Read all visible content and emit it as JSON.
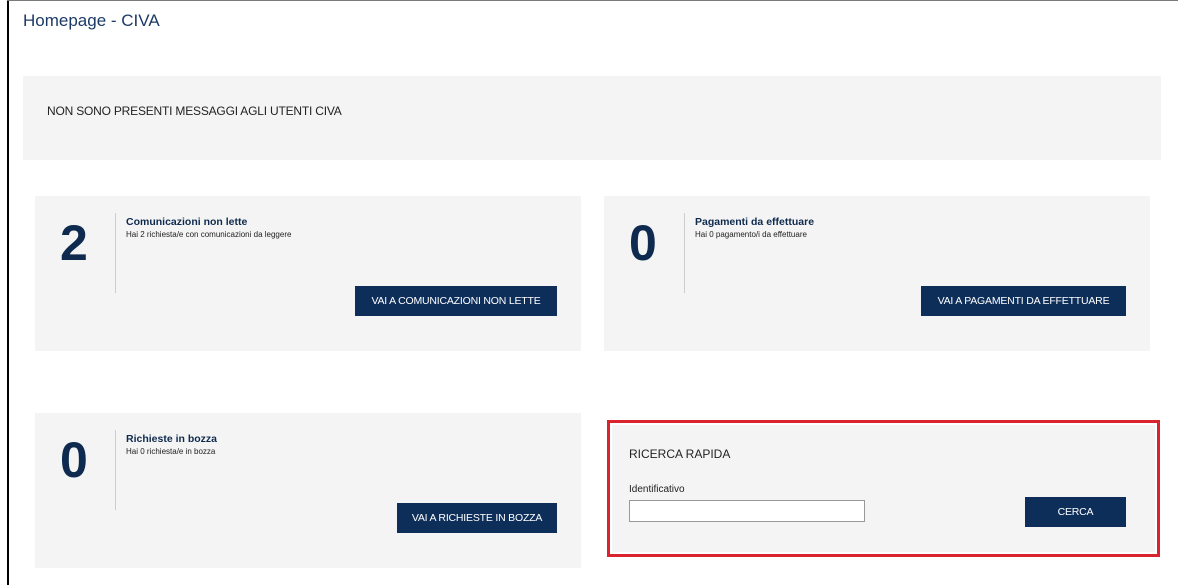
{
  "page": {
    "title": "Homepage - CIVA"
  },
  "messages": {
    "text": "NON SONO PRESENTI MESSAGGI AGLI UTENTI CIVA"
  },
  "cards": {
    "unread": {
      "count": "2",
      "title": "Comunicazioni non lette",
      "subtitle": "Hai 2 richiesta/e con comunicazioni da leggere",
      "button": "VAI A COMUNICAZIONI NON LETTE"
    },
    "payments": {
      "count": "0",
      "title": "Pagamenti da effettuare",
      "subtitle": "Hai 0 pagamento/i da effettuare",
      "button": "VAI A PAGAMENTI DA EFFETTUARE"
    },
    "drafts": {
      "count": "0",
      "title": "Richieste in bozza",
      "subtitle": "Hai 0 richiesta/e in bozza",
      "button": "VAI A RICHIESTE IN BOZZA"
    }
  },
  "quick_search": {
    "title": "RICERCA RAPIDA",
    "field_label": "Identificativo",
    "field_value": "",
    "button": "CERCA"
  },
  "colors": {
    "primary": "#0e2e5a",
    "panel_bg": "#f4f4f4",
    "highlight_border": "#d9242f"
  }
}
